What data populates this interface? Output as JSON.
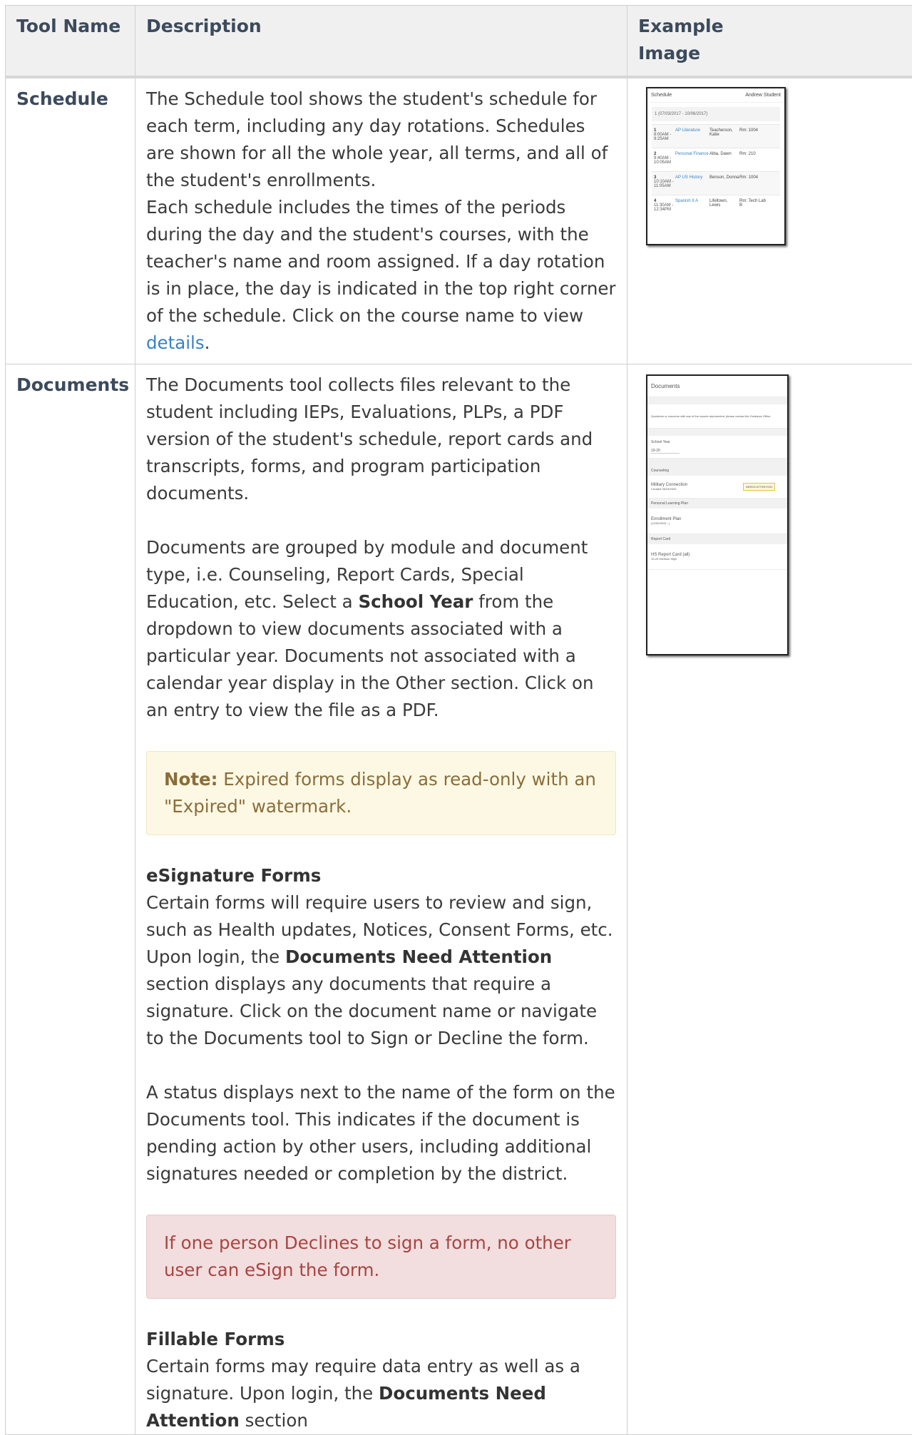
{
  "table": {
    "headers": {
      "tool_name": "Tool Name",
      "description": "Description",
      "example_image": "Example Image"
    },
    "rows": [
      {
        "name": "Schedule",
        "description": {
          "p1": "The Schedule tool shows the student's schedule for each term, including any day rotations. Schedules are shown for all the whole year, all terms, and all of the student's enrollments.",
          "p2_before_link": "Each schedule includes the times of the periods during the day and the student's courses, with the teacher's name and room assigned. If a day rotation is in place, the day is indicated in the top right corner of the schedule. Click on the course name to view ",
          "link_text": "details",
          "p2_after_link": "."
        },
        "thumbnail": {
          "title": "Schedule",
          "user": "Andrew Student",
          "term": "1   (07/03/2017 - 10/06/2017)",
          "rows": [
            {
              "period": "1",
              "time": "8:00AM - 9:25AM",
              "course": "AP Literature",
              "teacher": "Teacherson, Katie",
              "room": "Rm: 1004"
            },
            {
              "period": "2",
              "time": "9:40AM - 10:05AM",
              "course": "Personal Finance",
              "teacher": "Alba, Dawn",
              "room": "Rm: 210"
            },
            {
              "period": "3",
              "time": "10:10AM - 11:05AM",
              "course": "AP US History",
              "teacher": "Benson, Donna",
              "room": "Rm: 1004"
            },
            {
              "period": "4",
              "time": "11:30AM - 12:34PM",
              "course": "Spanish II A",
              "teacher": "Lifeltown, Lewis",
              "room": "Rm: Tech Lab B"
            }
          ]
        }
      },
      {
        "name": "Documents",
        "description": {
          "p1": "The Documents tool collects files relevant to the student including IEPs, Evaluations, PLPs, a PDF version of the student's schedule, report cards and transcripts, forms, and program participation documents.",
          "p2_before_bold": "Documents are grouped by module and document type, i.e. Counseling, Report Cards, Special Education, etc. Select a ",
          "p2_bold": "School Year",
          "p2_after_bold": " from the dropdown to view documents associated with a particular year. Documents not associated with a calendar year display in the Other section. Click on an entry to view the file as a PDF.",
          "note_label": "Note:",
          "note_text": " Expired forms display as read-only with an \"Expired\" watermark.",
          "esig_heading": "eSignature Forms",
          "esig_p1_before": "Certain forms will require users to review and sign, such as Health updates, Notices, Consent Forms, etc. Upon login, the ",
          "esig_p1_bold": "Documents Need Attention",
          "esig_p1_after": " section displays any documents that require a signature. Click on the document name or navigate to the Documents tool to Sign or Decline the form.",
          "esig_p2": "A status displays next to the name of the form on the Documents tool. This indicates if the document is pending action by other users, including additional signatures needed or completion by the district.",
          "warning": "If one person Declines to sign a form, no other user can eSign the form.",
          "fill_heading": "Fillable Forms",
          "fill_p1_before": "Certain forms may require data entry as well as a signature. Upon login, the ",
          "fill_p1_bold": "Documents Need Attention",
          "fill_p1_after": " section"
        },
        "thumbnail": {
          "title": "Documents",
          "notice": "Questions or concerns with any of the reports represented, please contact the Guidance Office.",
          "school_year_label": "School Year",
          "school_year_value": "19-20",
          "sections": [
            {
              "heading": "Counseling",
              "item": "Military Connection",
              "sub": "Created 06/24/2020",
              "badge": "NEEDS ATTENTION"
            },
            {
              "heading": "Personal Learning Plan",
              "item": "Enrollment Plan",
              "sub": "(12/02/2019 - )",
              "badge": ""
            },
            {
              "heading": "Report Card",
              "item": "HS Report Card (all)",
              "sub": "19-20 Harrison High",
              "badge": ""
            }
          ]
        }
      }
    ]
  }
}
